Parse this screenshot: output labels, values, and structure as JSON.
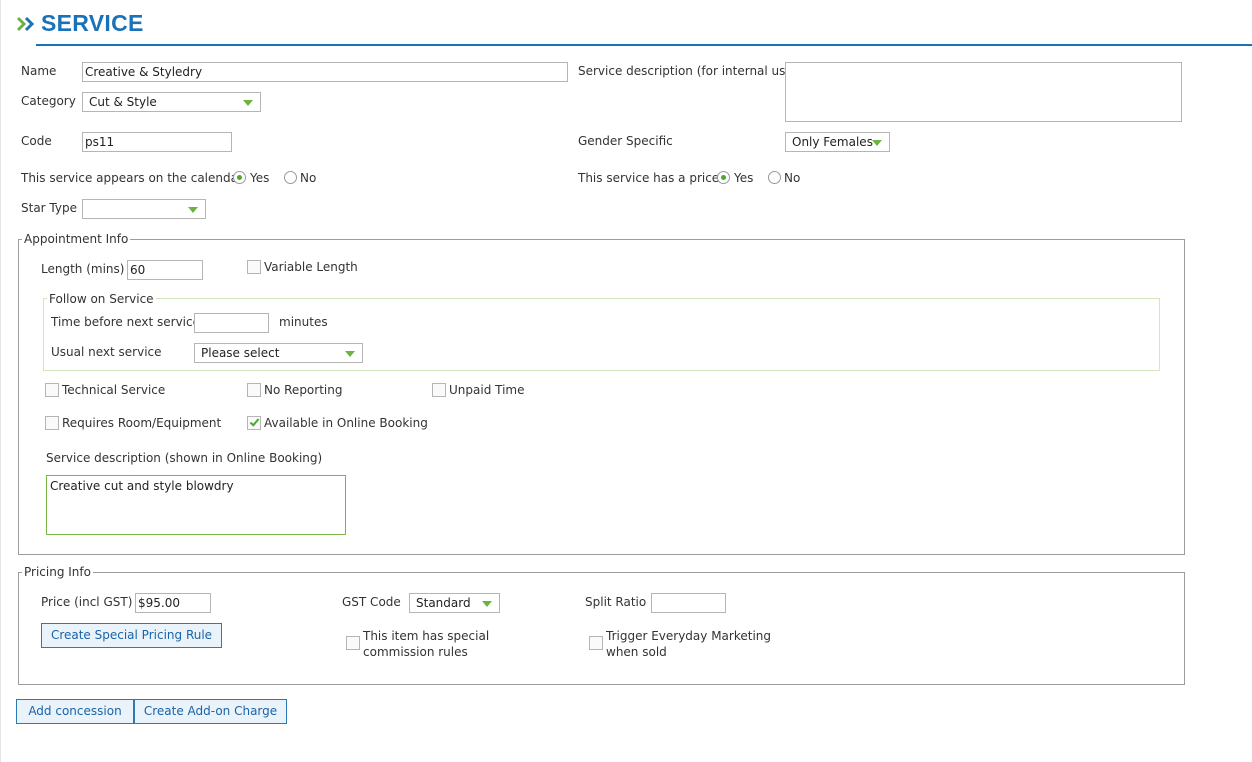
{
  "page": {
    "title": "SERVICE"
  },
  "colors": {
    "brand": "#1a72b8",
    "accent_green": "#6db33f"
  },
  "icons": {
    "title": "double-chevron-right-icon",
    "dropdown": "green-triangle-down-icon"
  },
  "service": {
    "name_label": "Name",
    "name_value": "Creative & Styledry",
    "category_label": "Category",
    "category_value": "Cut & Style",
    "code_label": "Code",
    "code_value": "ps11",
    "internal_desc_label": "Service description (for internal use)",
    "internal_desc_value": "",
    "gender_label": "Gender Specific",
    "gender_value": "Only Females",
    "calendar_label": "This service appears on the calendar",
    "calendar_yes": "Yes",
    "calendar_no": "No",
    "calendar_selected": "Yes",
    "price_flag_label": "This service has a price",
    "price_flag_yes": "Yes",
    "price_flag_no": "No",
    "price_flag_selected": "Yes",
    "star_type_label": "Star Type",
    "star_type_value": ""
  },
  "appointment": {
    "legend": "Appointment Info",
    "length_label": "Length (mins)",
    "length_value": "60",
    "variable_length_label": "Variable Length",
    "variable_length_checked": false,
    "follow_on": {
      "legend": "Follow on Service",
      "time_before_label": "Time before next service",
      "time_before_value": "",
      "minutes_label": "minutes",
      "usual_next_label": "Usual next service",
      "usual_next_value": "Please select"
    },
    "technical_label": "Technical Service",
    "technical_checked": false,
    "no_reporting_label": "No Reporting",
    "no_reporting_checked": false,
    "unpaid_time_label": "Unpaid Time",
    "unpaid_time_checked": false,
    "requires_room_label": "Requires Room/Equipment",
    "requires_room_checked": false,
    "online_booking_label": "Available in Online Booking",
    "online_booking_checked": true,
    "online_desc_label": "Service description (shown in Online Booking)",
    "online_desc_value": "Creative cut and style blowdry"
  },
  "pricing": {
    "legend": "Pricing Info",
    "price_label": "Price (incl GST)",
    "price_value": "$95.00",
    "gst_label": "GST Code",
    "gst_value": "Standard",
    "split_label": "Split Ratio",
    "split_value": "",
    "special_pricing_button": "Create Special Pricing Rule",
    "commission_label_line1": "This item has special",
    "commission_label_line2": "commission rules",
    "commission_checked": false,
    "marketing_label_line1": "Trigger Everyday Marketing",
    "marketing_label_line2": "when sold",
    "marketing_checked": false
  },
  "footer": {
    "add_concession_button": "Add concession",
    "addon_charge_button": "Create Add-on Charge"
  }
}
